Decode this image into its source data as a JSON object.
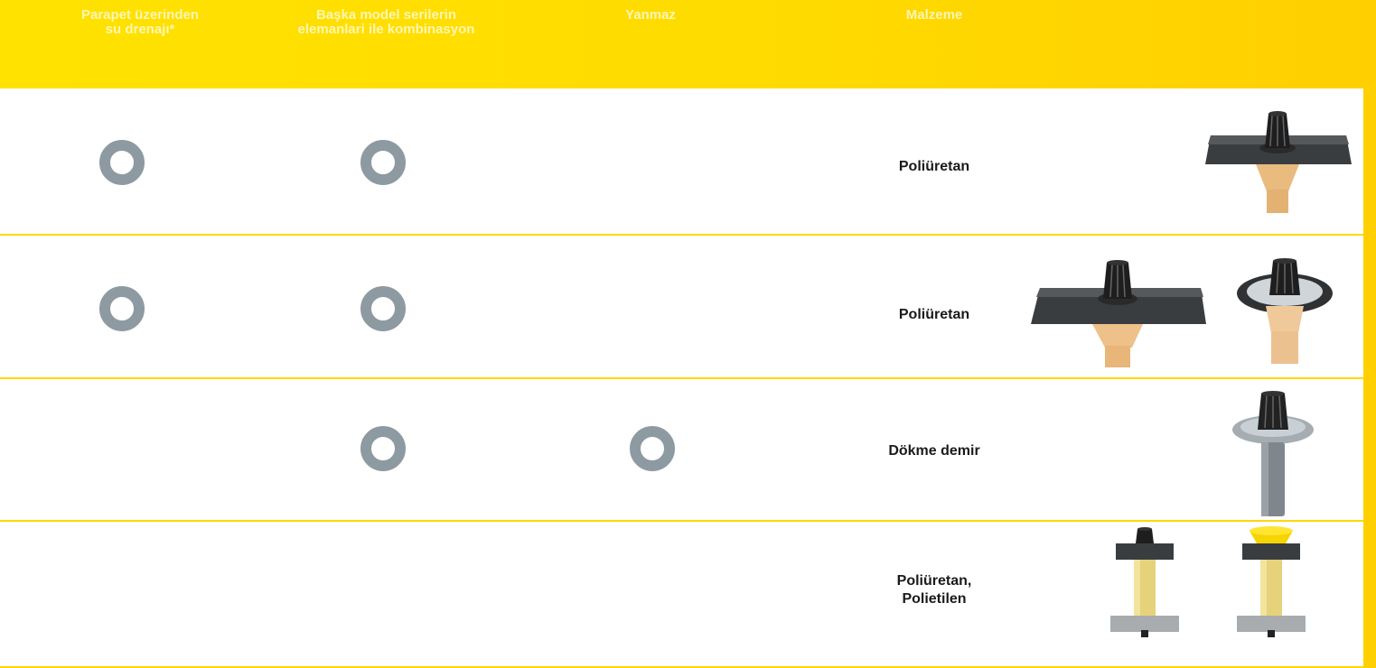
{
  "header": {
    "columns": [
      {
        "label": "Parapet üzerinden\nsu drenajı*"
      },
      {
        "label": "Başka model serilerin\nelemanlari ile kombinasyon"
      },
      {
        "label": "Yanmaz"
      },
      {
        "label": "Malzeme"
      }
    ]
  },
  "rows": [
    {
      "parapet": true,
      "combination": true,
      "fireproof": false,
      "material": "Poliüretan",
      "products": [
        "drain-square-flange-pu"
      ]
    },
    {
      "parapet": true,
      "combination": true,
      "fireproof": false,
      "material": "Poliüretan",
      "products": [
        "drain-square-flange-pu",
        "drain-round-flange-pu"
      ]
    },
    {
      "parapet": false,
      "combination": true,
      "fireproof": true,
      "material": "Dökme demir",
      "products": [
        "drain-cast-iron"
      ]
    },
    {
      "parapet": false,
      "combination": false,
      "fireproof": false,
      "material": "Poliüretan,\nPolietilen",
      "products": [
        "drain-extension-black-grate",
        "drain-extension-yellow-cap"
      ]
    }
  ],
  "colors": {
    "mark": "#8E9AA1",
    "accent": "#FFDB00",
    "row_divider": "#FFD800"
  }
}
